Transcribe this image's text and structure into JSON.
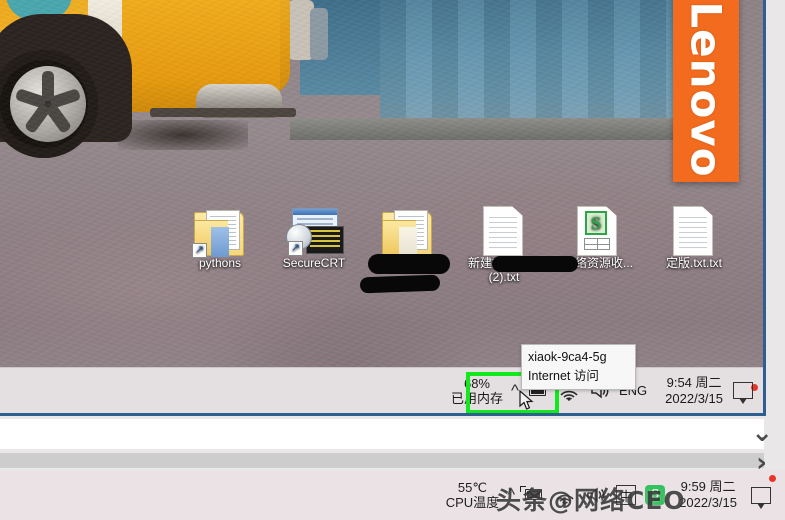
{
  "wallpaper": {
    "lenovo_logo": "Lenovo"
  },
  "desktop_icons": [
    {
      "name": "pythons",
      "label": "pythons",
      "icon": "folder-shortcut-icon"
    },
    {
      "name": "securecrt",
      "label": "SecureCRT",
      "icon": "securecrt-shortcut-icon"
    },
    {
      "name": "redacted-folder",
      "label": "",
      "icon": "folder-icon"
    },
    {
      "name": "new-text-doc",
      "label": "新建文本文档 (2).txt",
      "icon": "text-file-icon"
    },
    {
      "name": "network-resource",
      "label": "网络资源收...",
      "icon": "spreadsheet-file-icon"
    },
    {
      "name": "final-txt",
      "label": "定版.txt.txt",
      "icon": "text-file-icon"
    }
  ],
  "inner_taskbar": {
    "memory_percent": "68%",
    "memory_label": "已用内存",
    "expand_icon": "chevron-up-icon",
    "tray_icons": [
      "battery-charging-icon",
      "wifi-icon",
      "volume-icon"
    ],
    "language": "ENG",
    "clock_time": "9:54 周二",
    "clock_date": "2022/3/15",
    "notification_icon": "notification-balloon-icon"
  },
  "tooltip": {
    "ssid": "xiaok-9ca4-5g",
    "status": "Internet 访问"
  },
  "highlight": {
    "color": "#12e81b",
    "target": "wifi-tray-icon"
  },
  "host_taskbar": {
    "cpu_temp": "55℃",
    "cpu_label": "CPU温度",
    "expand_icon": "chevron-up-icon",
    "tray_icons": [
      "battery-charging-icon",
      "wifi-icon",
      "volume-icon"
    ],
    "ime_label": "中",
    "sogou_label": "S",
    "clock_time": "9:59 周二",
    "clock_date": "2022/3/15",
    "notification_icon": "notification-balloon-icon"
  },
  "overlay": {
    "watermark": "头条@网络CEO",
    "scroll_down_icon": "chevron-down-icon",
    "next_icon": "chevron-right-icon"
  }
}
